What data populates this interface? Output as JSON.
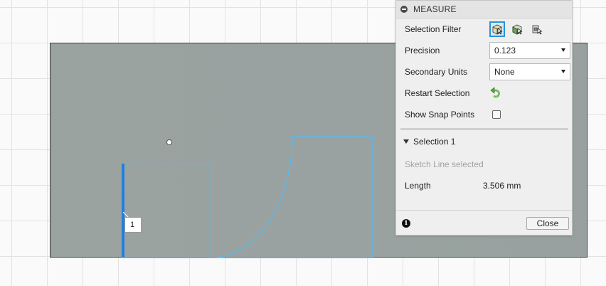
{
  "canvas": {
    "point_label": "1"
  },
  "panel": {
    "title": "MEASURE",
    "selection_filter": {
      "label": "Selection Filter",
      "icons": [
        "select-body-icon",
        "select-face-icon",
        "select-component-icon"
      ],
      "active_index": 0
    },
    "precision": {
      "label": "Precision",
      "value": "0.123"
    },
    "secondary_units": {
      "label": "Secondary Units",
      "value": "None"
    },
    "restart_selection": {
      "label": "Restart Selection",
      "icon": "restart-icon"
    },
    "show_snap_points": {
      "label": "Show Snap Points",
      "checked": false
    },
    "selection": {
      "title": "Selection 1",
      "status": "Sketch Line selected",
      "length_label": "Length",
      "length_value": "3.506 mm"
    },
    "close_label": "Close",
    "info_icon": "info-icon"
  },
  "colors": {
    "accent": "#2c92d6",
    "sketch_line": "#5db7e8",
    "selected_line": "#1f7fe0",
    "slab": "#9aa3a0"
  }
}
